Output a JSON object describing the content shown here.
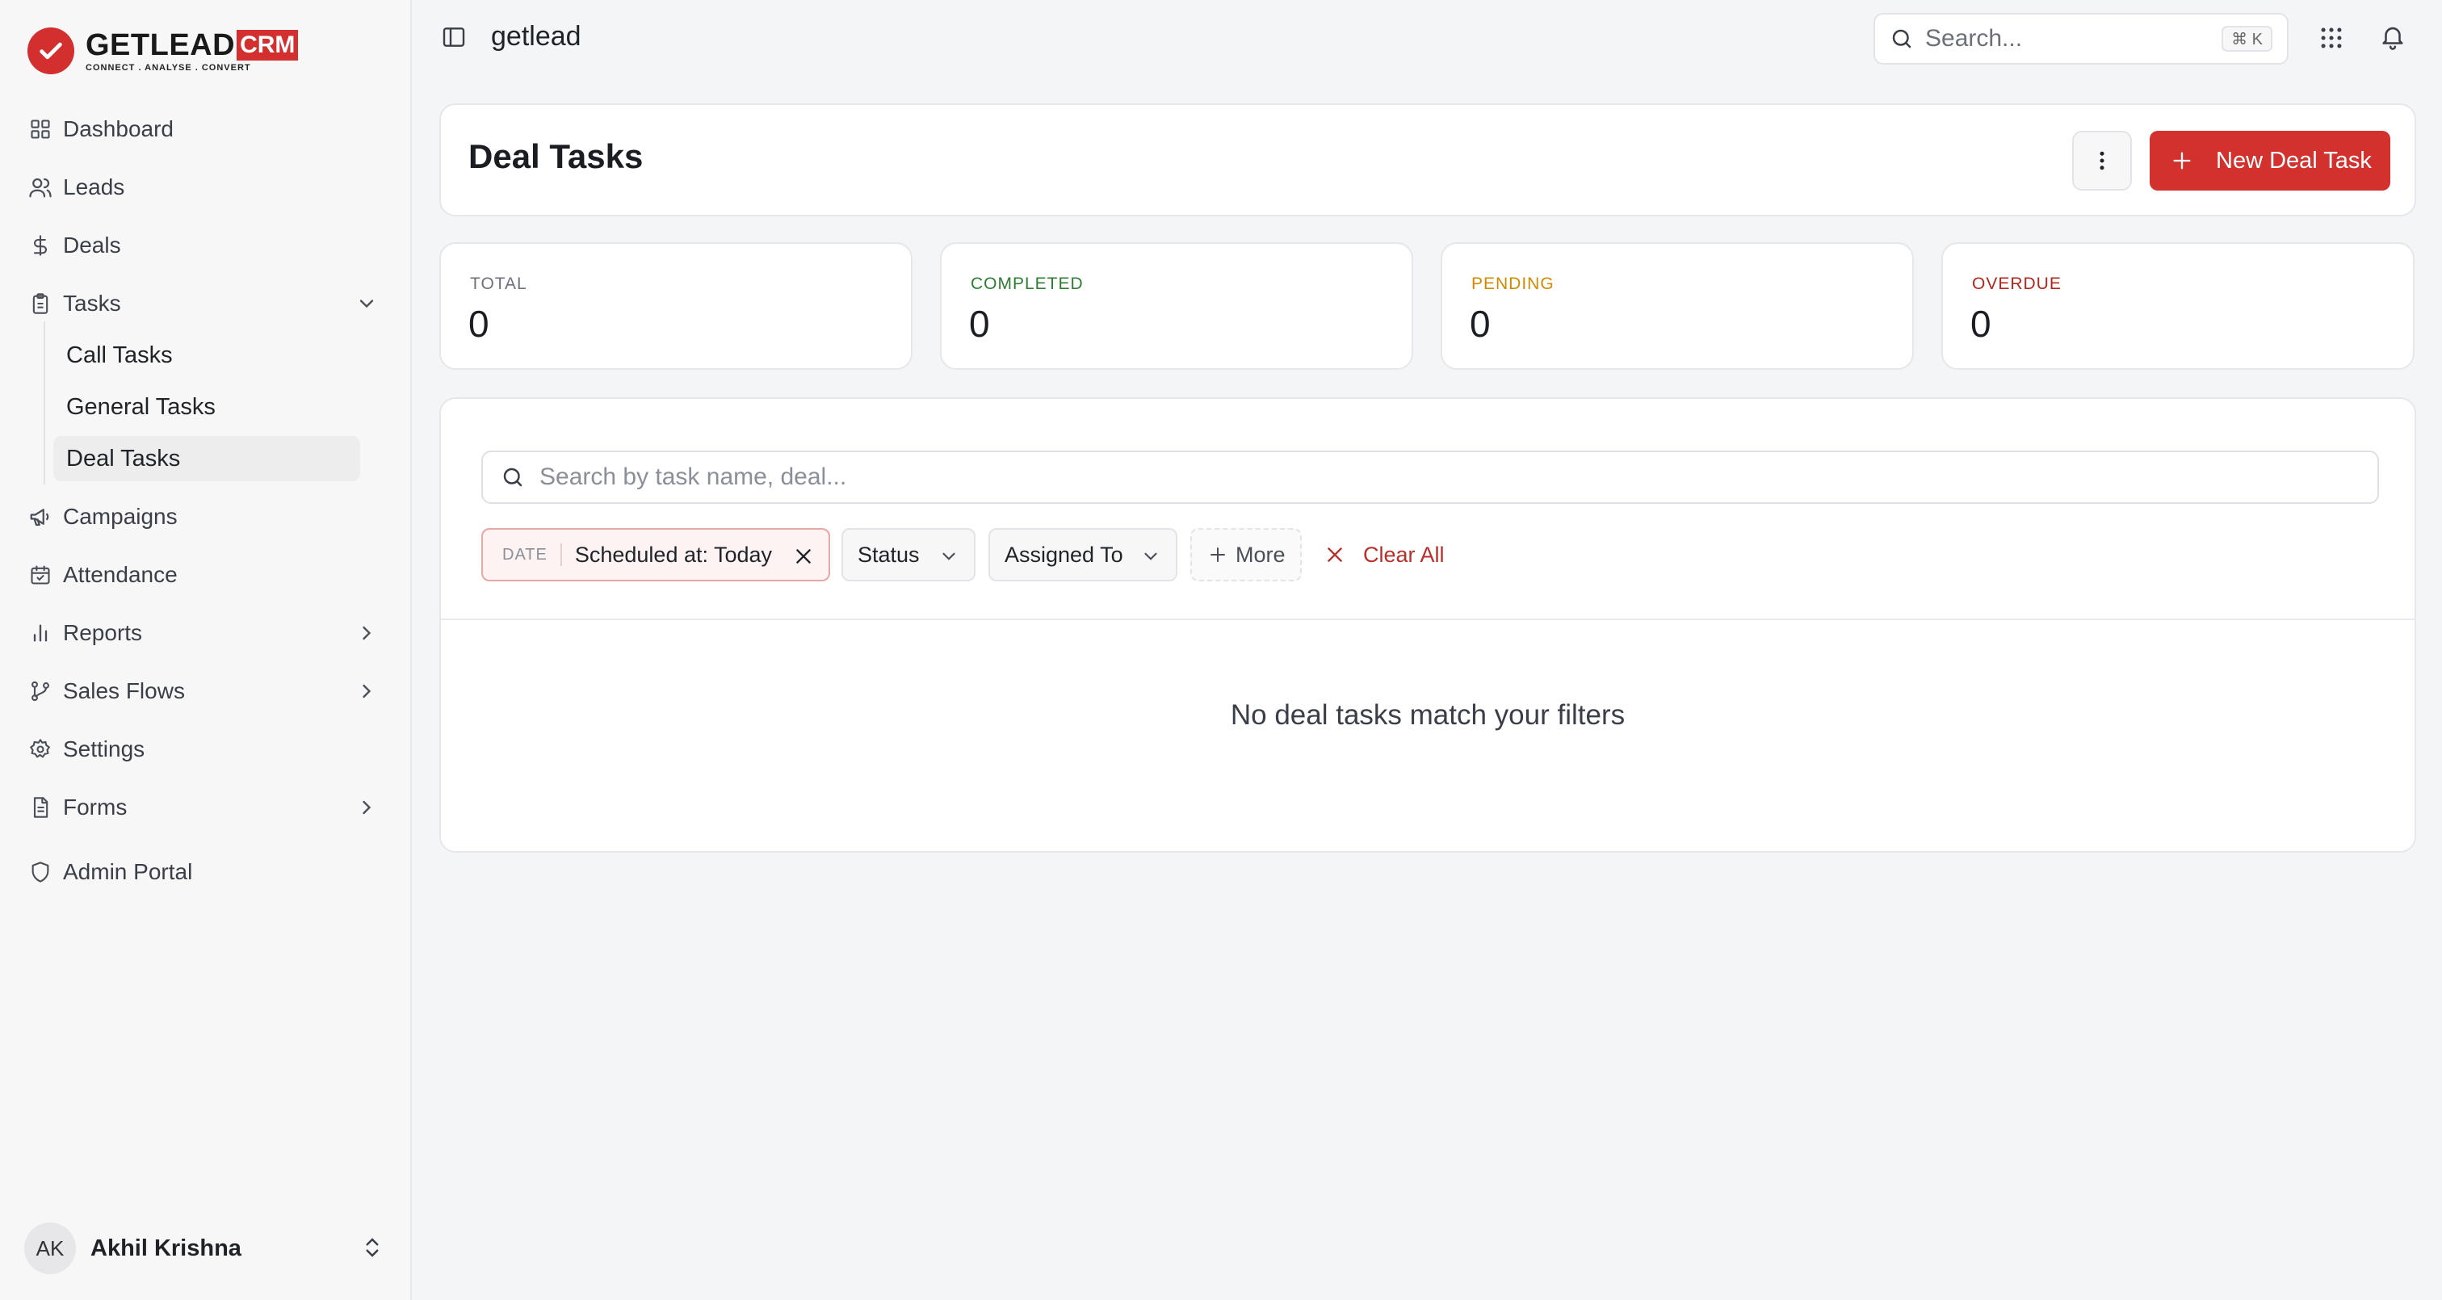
{
  "brand": {
    "logo_name": "GETLEAD",
    "logo_crm": "CRM",
    "logo_tagline": "CONNECT  .  ANALYSE  .  CONVERT",
    "workspace_title": "getlead"
  },
  "sidebar": {
    "items": [
      {
        "label": "Dashboard",
        "icon": "grid-icon"
      },
      {
        "label": "Leads",
        "icon": "users-icon"
      },
      {
        "label": "Deals",
        "icon": "dollar-icon"
      },
      {
        "label": "Tasks",
        "icon": "clipboard-icon",
        "expanded": true
      },
      {
        "label": "Campaigns",
        "icon": "megaphone-icon"
      },
      {
        "label": "Attendance",
        "icon": "calendar-check-icon"
      },
      {
        "label": "Reports",
        "icon": "bar-chart-icon"
      },
      {
        "label": "Sales Flows",
        "icon": "git-branch-icon"
      },
      {
        "label": "Settings",
        "icon": "gear-icon"
      },
      {
        "label": "Forms",
        "icon": "file-text-icon"
      },
      {
        "label": "Admin Portal",
        "icon": "shield-icon"
      }
    ],
    "task_subitems": [
      {
        "label": "Call Tasks"
      },
      {
        "label": "General Tasks"
      },
      {
        "label": "Deal Tasks",
        "active": true
      }
    ],
    "user": {
      "initials": "AK",
      "name": "Akhil Krishna"
    }
  },
  "topbar": {
    "search_placeholder": "Search...",
    "search_shortcut": "⌘ K"
  },
  "header": {
    "title": "Deal Tasks",
    "new_button_label": "New Deal Task"
  },
  "stats": [
    {
      "label": "TOTAL",
      "value": "0",
      "color": "#6b7079"
    },
    {
      "label": "COMPLETED",
      "value": "0",
      "color": "#2e7d32"
    },
    {
      "label": "PENDING",
      "value": "0",
      "color": "#d08a00"
    },
    {
      "label": "OVERDUE",
      "value": "0",
      "color": "#b3261e"
    }
  ],
  "list": {
    "search_placeholder": "Search by task name, deal...",
    "filters": {
      "date_tag": "DATE",
      "date_value": "Scheduled at: Today",
      "status_label": "Status",
      "assigned_label": "Assigned To",
      "more_label": "More",
      "clear_label": "Clear All"
    },
    "empty_message": "No deal tasks match your filters"
  },
  "colors": {
    "accent": "#d3312e",
    "sidebar_bg": "#f7f7f8",
    "page_bg": "#f4f5f7"
  }
}
